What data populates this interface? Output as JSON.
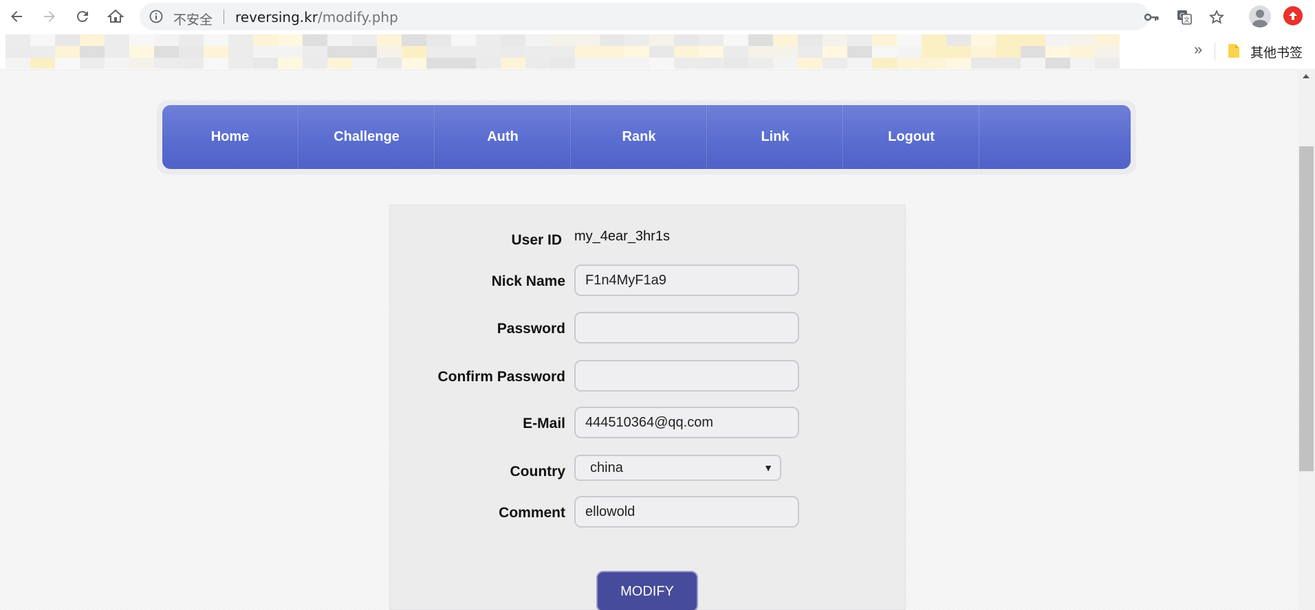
{
  "browser": {
    "security_label": "不安全",
    "url_host": "reversing.kr",
    "url_path": "/modify.php",
    "icons": [
      "back-icon",
      "forward-icon",
      "reload-icon",
      "home-icon",
      "info-icon",
      "key-icon",
      "translate-icon",
      "star-icon",
      "profile-icon",
      "update-icon"
    ]
  },
  "bookmarks": {
    "more": "»",
    "other_label": "其他书签"
  },
  "site_nav": {
    "items": [
      "Home",
      "Challenge",
      "Auth",
      "Rank",
      "Link",
      "Logout"
    ]
  },
  "form": {
    "user_id_label": "User ID",
    "user_id_value": "my_4ear_3hr1s",
    "nick_label": "Nick Name",
    "nick_value": "F1n4MyF1a9",
    "password_label": "Password",
    "password_value": "",
    "confirm_label": "Confirm Password",
    "confirm_value": "",
    "email_label": "E-Mail",
    "email_value": "444510364@qq.com",
    "country_label": "Country",
    "country_value": "china",
    "comment_label": "Comment",
    "comment_value": "ellowold",
    "submit_label": "MODIFY"
  }
}
